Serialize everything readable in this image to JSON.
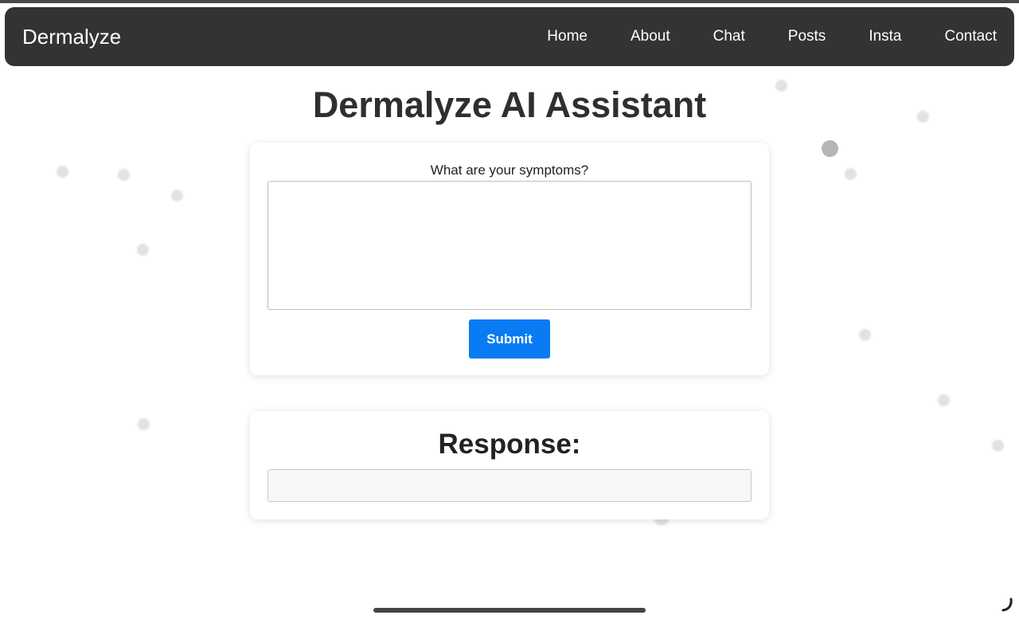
{
  "navbar": {
    "brand": "Dermalyze",
    "links": [
      "Home",
      "About",
      "Chat",
      "Posts",
      "Insta",
      "Contact"
    ]
  },
  "main": {
    "title": "Dermalyze AI Assistant",
    "form": {
      "label": "What are your symptoms?",
      "textarea_value": "",
      "submit_label": "Submit"
    },
    "response": {
      "title": "Response:",
      "value": ""
    }
  },
  "colors": {
    "navbar_bg": "#333333",
    "accent": "#0a7bf2",
    "background": "#ffffff"
  }
}
